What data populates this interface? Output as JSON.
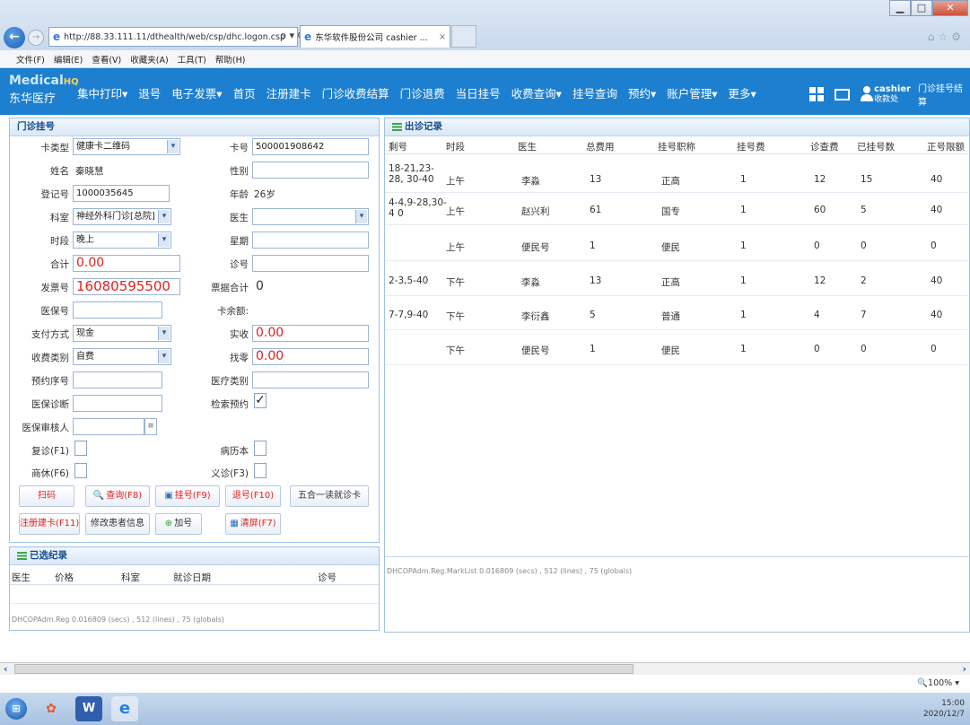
{
  "browser": {
    "url": "http://88.33.111.11/dthealth/web/csp/dhc.logon.csp",
    "addr_tools": "ρ ▾ C",
    "tab_title": "东华软件股份公司 cashier ...",
    "menu": [
      "文件(F)",
      "编辑(E)",
      "查看(V)",
      "收藏夹(A)",
      "工具(T)",
      "帮助(H)"
    ]
  },
  "app": {
    "brand_main": "Medical",
    "brand_hq": "HQ",
    "brand_sub": "东华医疗",
    "nav": [
      "集中打印▾",
      "退号",
      "电子发票▾",
      "首页",
      "注册建卡",
      "门诊收费结算",
      "门诊退费",
      "当日挂号",
      "收费查询▾",
      "挂号查询",
      "预约▾",
      "账户管理▾",
      "更多▾"
    ],
    "user": "cashier",
    "user_role": "收款处",
    "dept": "门诊挂号结算"
  },
  "reg_panel": {
    "title": "门诊挂号",
    "labels": {
      "card_type": "卡类型",
      "card_no": "卡号",
      "name": "姓名",
      "sex": "性别",
      "reg_no": "登记号",
      "age": "年龄",
      "dept": "科室",
      "doctor": "医生",
      "period": "时段",
      "week": "星期",
      "total": "合计",
      "room": "诊号",
      "invoice": "发票号",
      "bill_total": "票据合计",
      "insurance_no": "医保号",
      "card_balance": "卡余额:",
      "pay_method": "支付方式",
      "paid": "实收",
      "fee_type": "收费类别",
      "change": "找零",
      "appt_no": "预约序号",
      "med_type": "医疗类别",
      "ins_diag": "医保诊断",
      "check_appt": "检索预约",
      "ins_auditor": "医保审核人",
      "revisit": "复诊(F1)",
      "record_book": "病历本",
      "commercial": "商休(F6)",
      "free_clinic": "义诊(F3)"
    },
    "values": {
      "card_type": "健康卡二维码",
      "card_no": "500001908642",
      "name": "秦晓慧",
      "reg_no": "1000035645",
      "age": "26岁",
      "dept": "神经外科门诊[总院]",
      "period": "晚上",
      "total": "0.00",
      "invoice": "16080595500",
      "bill_total": "0",
      "pay_method": "现金",
      "paid": "0.00",
      "fee_type": "自费",
      "change": "0.00"
    },
    "check_appt_mark": "✓",
    "buttons": {
      "scan": "扫码",
      "query": "查询(F8)",
      "register": "挂号(F9)",
      "refund": "退号(F10)",
      "five_in_one": "五合一读就诊卡",
      "new_card": "注册建卡(F11)",
      "edit_patient": "修改患者信息",
      "add_number": "加号",
      "clear": "清屏(F7)"
    }
  },
  "selected_panel": {
    "title": "已选纪录",
    "headers": [
      "医生",
      "价格",
      "科室",
      "就诊日期",
      "诊号"
    ],
    "footnote": "DHCOPAdm.Reg 0.016809 (secs) , 512 (lines) , 75 (globals)"
  },
  "schedule_panel": {
    "title": "出诊记录",
    "headers": [
      "剩号",
      "时段",
      "医生",
      "总费用",
      "挂号职称",
      "挂号费",
      "诊查费",
      "已挂号数",
      "正号限额"
    ],
    "rows": [
      [
        "18-21,23-28, 30-40",
        "上午",
        "李淼",
        "13",
        "正高",
        "1",
        "12",
        "15",
        "40"
      ],
      [
        "4-4,9-28,30-4 0",
        "上午",
        "赵兴利",
        "61",
        "国专",
        "1",
        "60",
        "5",
        "40"
      ],
      [
        "",
        "上午",
        "便民号",
        "1",
        "便民",
        "1",
        "0",
        "0",
        "0"
      ],
      [
        "2-3,5-40",
        "下午",
        "李淼",
        "13",
        "正高",
        "1",
        "12",
        "2",
        "40"
      ],
      [
        "7-7,9-40",
        "下午",
        "李衍鑫",
        "5",
        "普通",
        "1",
        "4",
        "7",
        "40"
      ],
      [
        "",
        "下午",
        "便民号",
        "1",
        "便民",
        "1",
        "0",
        "0",
        "0"
      ]
    ],
    "footnote": "DHCOPAdm.Reg.MarkList 0.016809 (secs) , 512 (lines) , 75 (globals)"
  },
  "status": {
    "zoom": "100%",
    "time": "15:00",
    "date": "2020/12/7"
  },
  "colors": {
    "appbar": "#1d7fd0",
    "red_value": "#e02020",
    "panel_border": "#9fc1e6"
  }
}
